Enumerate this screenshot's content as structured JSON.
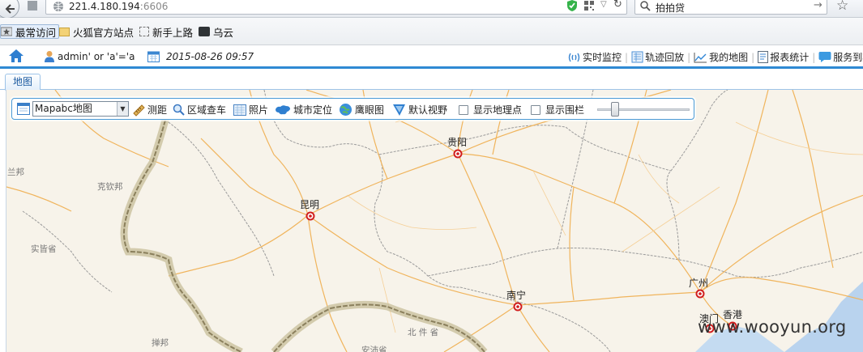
{
  "browser": {
    "url_host": "221.4.180.194",
    "url_port": ":6606",
    "search_text": "拍拍贷"
  },
  "bookmarks": [
    {
      "label": "最常访问",
      "icon": "star-icon"
    },
    {
      "label": "火狐官方站点",
      "icon": "folder-icon"
    },
    {
      "label": "新手上路",
      "icon": "dashed-page-icon"
    },
    {
      "label": "乌云",
      "icon": "wooyun-icon"
    }
  ],
  "header": {
    "user_text": "admin' or 'a'='a",
    "datetime": "2015-08-26 09:57",
    "nav": [
      {
        "label": "实时监控",
        "icon": "monitor-icon"
      },
      {
        "label": "轨迹回放",
        "icon": "track-icon"
      },
      {
        "label": "我的地图",
        "icon": "my-map-icon"
      },
      {
        "label": "报表统计",
        "icon": "report-icon"
      },
      {
        "label": "服务到期坂",
        "icon": "chat-icon"
      }
    ]
  },
  "tabs": [
    {
      "label": "地图"
    }
  ],
  "toolbar": {
    "map_type": "Mapabc地图",
    "measure": "测距",
    "area_search": "区域查车",
    "photos": "照片",
    "city_locate": "城市定位",
    "eagle_eye": "鹰眼图",
    "default_view": "默认视野",
    "show_poi": "显示地理点",
    "show_fence": "显示围栏"
  },
  "map_labels": {
    "guiyang": "贵阳",
    "kunming": "昆明",
    "nanning": "南宁",
    "guangzhou": "广州",
    "macau": "澳门",
    "hongkong": "香港",
    "lanbang": "兰邦",
    "kechinbang": "克钦邦",
    "sagaing": "实皆省",
    "shan": "掸邦",
    "north": "北 件 省",
    "anpei": "安沛省"
  },
  "watermark": "www.wooyun.org",
  "colors": {
    "accent": "#2f8ad3",
    "map_bg": "#f7f3ea",
    "road": "#f3b865",
    "border": "#8f8a76"
  }
}
